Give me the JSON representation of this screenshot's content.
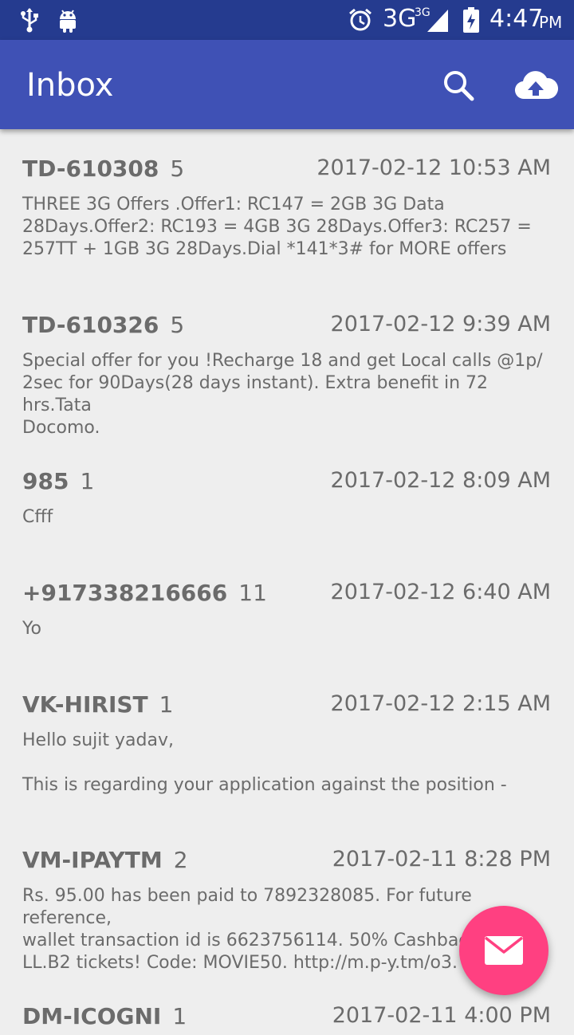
{
  "status_bar": {
    "network": "3G",
    "network_sup": "3G",
    "time": "4:47",
    "ampm": "PM",
    "icons": [
      "usb-icon",
      "android-icon",
      "alarm-icon",
      "signal-icon",
      "battery-charging-icon"
    ]
  },
  "app_bar": {
    "title": "Inbox",
    "actions": [
      "search-icon",
      "cloud-upload-icon"
    ]
  },
  "messages": [
    {
      "sender": "TD-610308",
      "count": "5",
      "date": "2017-02-12 10:53 AM",
      "body": "THREE 3G Offers .Offer1: RC147 = 2GB 3G Data\n28Days.Offer2: RC193 = 4GB 3G 28Days.Offer3: RC257 =\n257TT + 1GB 3G 28Days.Dial *141*3# for MORE offers"
    },
    {
      "sender": "TD-610326",
      "count": "5",
      "date": "2017-02-12 9:39 AM",
      "body": "Special offer for you !Recharge 18 and get Local calls @1p/\n2sec for 90Days(28 days instant). Extra benefit in 72 hrs.Tata\nDocomo."
    },
    {
      "sender": "985",
      "count": "1",
      "date": "2017-02-12 8:09 AM",
      "body": "Cfff"
    },
    {
      "sender": "+917338216666",
      "count": "11",
      "date": "2017-02-12 6:40 AM",
      "body": "Yo"
    },
    {
      "sender": "VK-HIRIST",
      "count": "1",
      "date": "2017-02-12 2:15 AM",
      "body": "Hello sujit yadav,\n\nThis is regarding your application against the position -"
    },
    {
      "sender": "VM-IPAYTM",
      "count": "2",
      "date": "2017-02-11 8:28 PM",
      "body": "Rs. 95.00 has been paid to 7892328085. For future reference,\nwallet transaction id is 6623756114. 50% Cashback on\nLL.B2 tickets! Code: MOVIE50. http://m.p-y.tm/o3. O"
    },
    {
      "sender": "DM-ICOGNI",
      "count": "1",
      "date": "2017-02-11 4:00 PM",
      "body": ""
    }
  ],
  "fab": {
    "icon": "mail-icon"
  },
  "colors": {
    "status_bar": "#253b8f",
    "app_bar": "#3f51b5",
    "fab": "#ff4081",
    "background": "#eeeeee",
    "text": "#6b6b6b"
  }
}
